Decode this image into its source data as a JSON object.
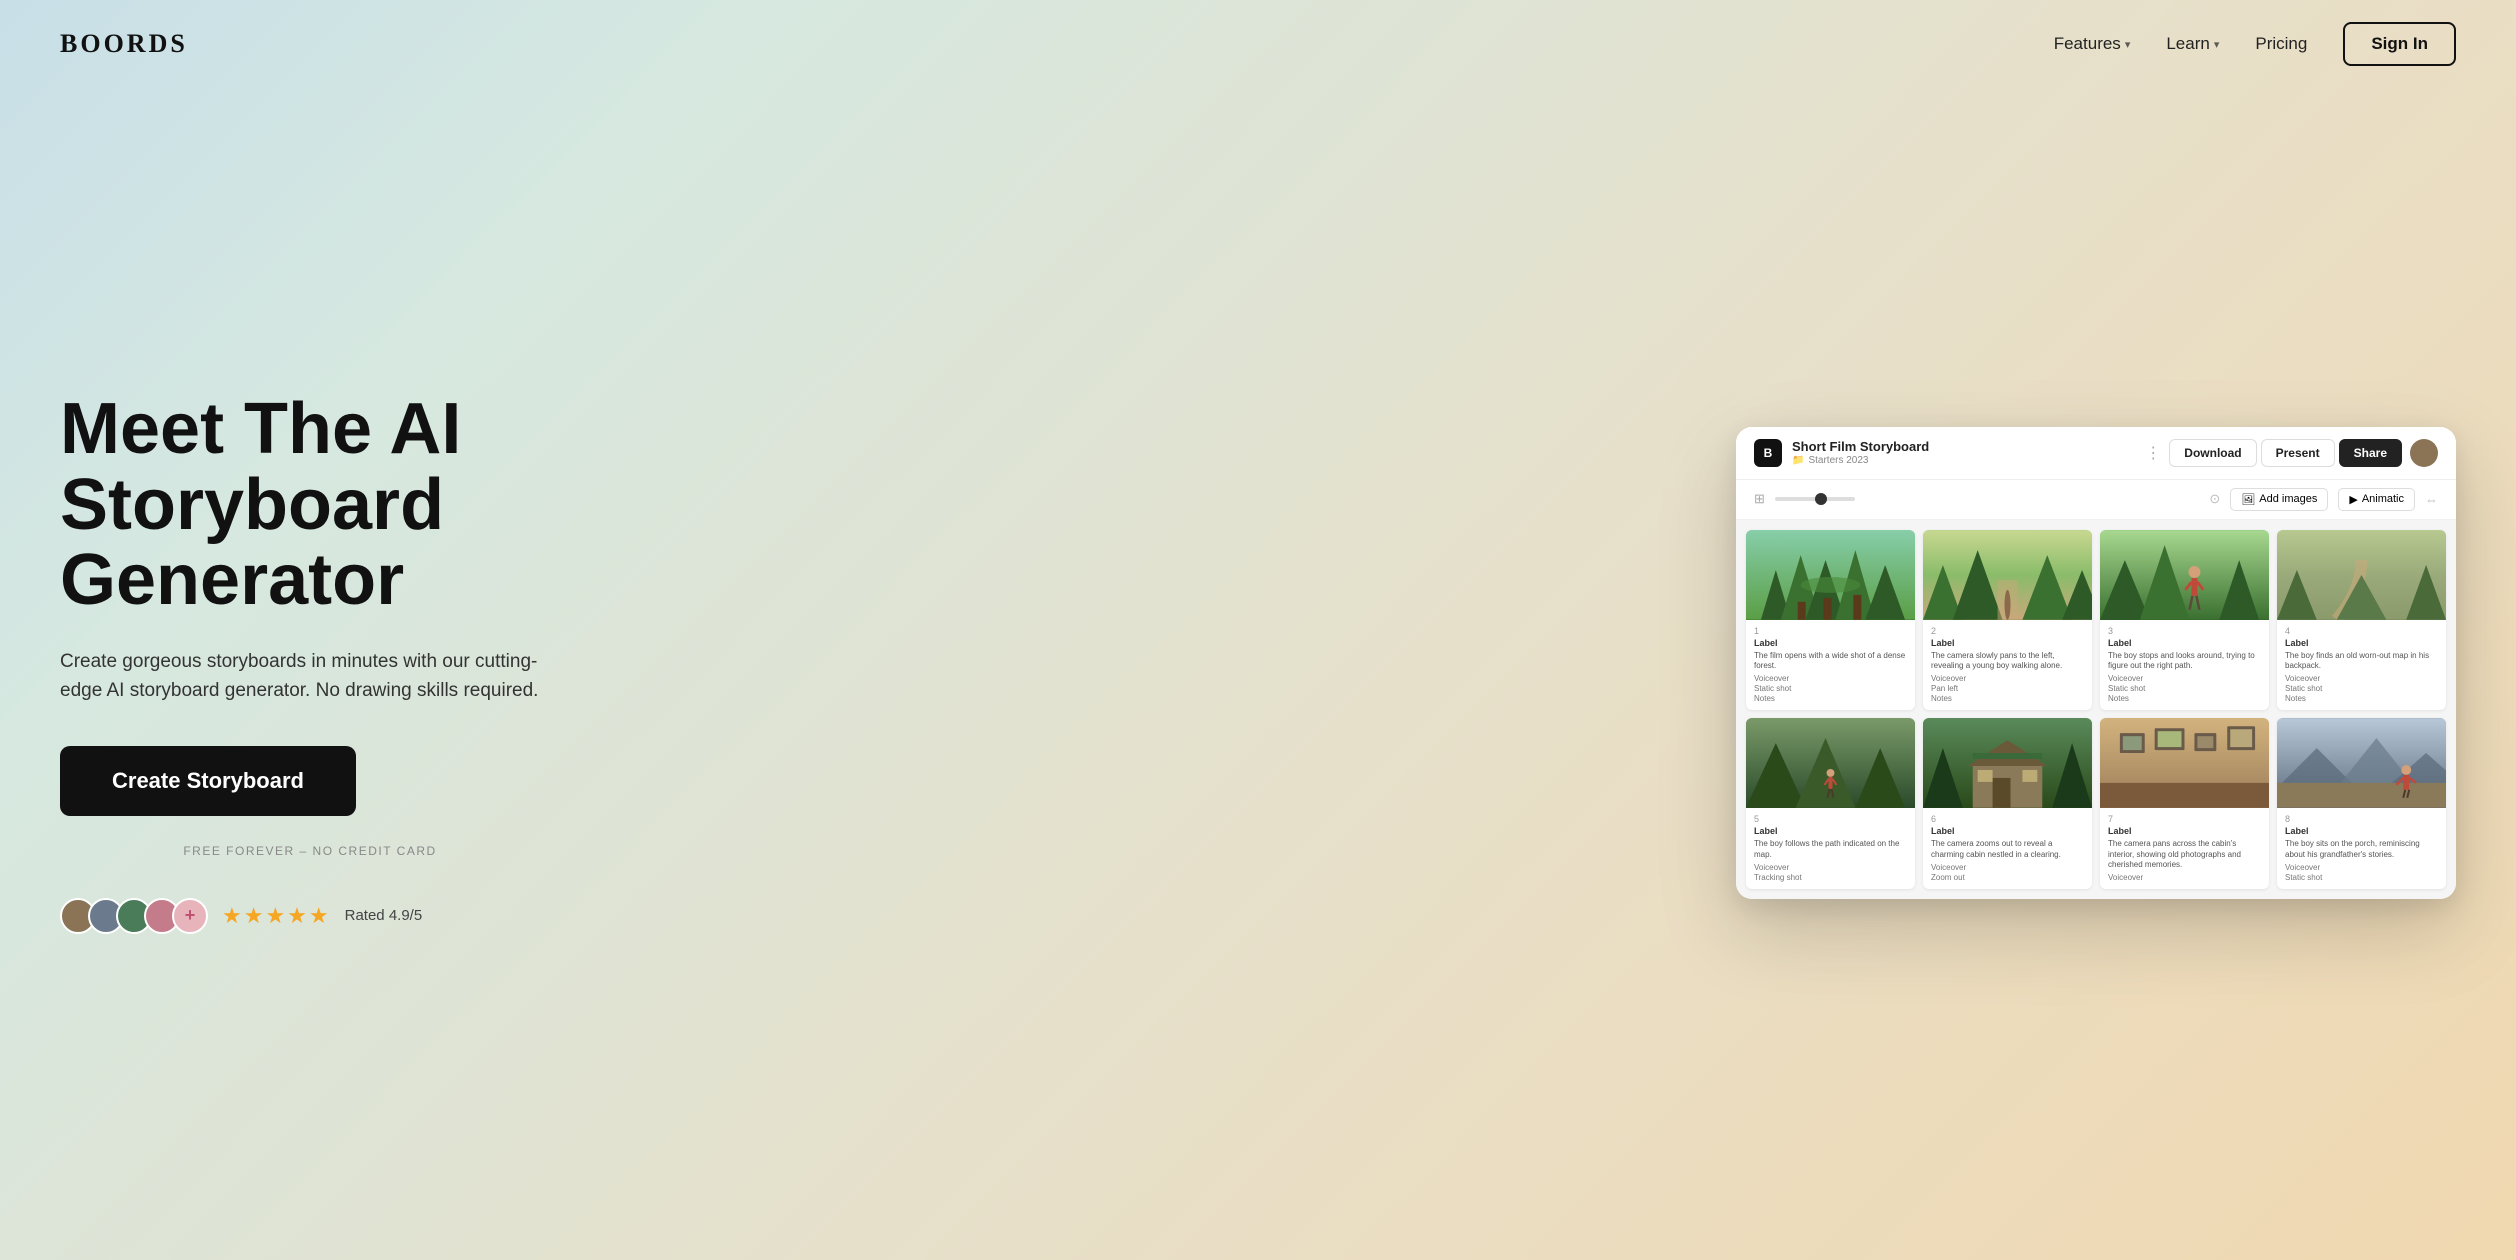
{
  "nav": {
    "logo": "BOORDS",
    "features_label": "Features",
    "learn_label": "Learn",
    "pricing_label": "Pricing",
    "signin_label": "Sign In"
  },
  "hero": {
    "title_line1": "Meet The AI",
    "title_line2": "Storyboard",
    "title_line3": "Generator",
    "subtitle": "Create gorgeous storyboards in minutes with our cutting-edge AI storyboard generator. No drawing skills required.",
    "cta_label": "Create Storyboard",
    "cta_subtext": "FREE FOREVER – NO CREDIT CARD",
    "rating_stars": "★★★★★",
    "rating_text": "Rated 4.9/5"
  },
  "app": {
    "title": "Short Film Storyboard",
    "subtitle": "Starters 2023",
    "download_label": "Download",
    "present_label": "Present",
    "share_label": "Share",
    "add_images_label": "Add images",
    "animatic_label": "Animatic",
    "cells": [
      {
        "number": "1",
        "label": "Label",
        "description": "The film opens with a wide shot of a dense forest.",
        "field1": "Voiceover",
        "field2": "Static shot",
        "field3": "Notes"
      },
      {
        "number": "2",
        "label": "Label",
        "description": "The camera slowly pans to the left, revealing a young boy walking alone.",
        "field1": "Voiceover",
        "field2": "Pan left",
        "field3": "Notes"
      },
      {
        "number": "3",
        "label": "Label",
        "description": "The boy stops and looks around, trying to figure out the right path.",
        "field1": "Voiceover",
        "field2": "Static shot",
        "field3": "Notes"
      },
      {
        "number": "4",
        "label": "Label",
        "description": "The boy finds an old worn-out map in his backpack.",
        "field1": "Voiceover",
        "field2": "Static shot",
        "field3": "Notes"
      },
      {
        "number": "5",
        "label": "Label",
        "description": "The boy follows the path indicated on the map.",
        "field1": "Voiceover",
        "field2": "Tracking shot"
      },
      {
        "number": "6",
        "label": "Label",
        "description": "The camera zooms out to reveal a charming cabin nestled in a clearing.",
        "field1": "Voiceover",
        "field2": "Zoom out"
      },
      {
        "number": "7",
        "label": "Label",
        "description": "The camera pans across the cabin's interior, showing old photographs and cherished memories.",
        "field1": "Voiceover"
      },
      {
        "number": "8",
        "label": "Label",
        "description": "The boy sits on the porch, reminiscing about his grandfather's stories.",
        "field1": "Voiceover",
        "field2": "Static shot"
      }
    ]
  }
}
